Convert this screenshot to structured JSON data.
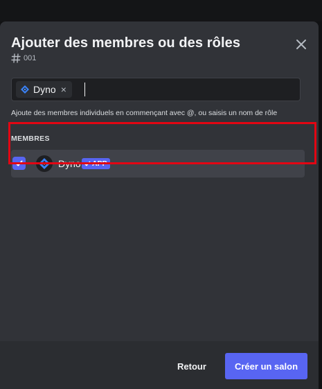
{
  "modal": {
    "title": "Ajouter des membres ou des rôles",
    "channel_name": "001"
  },
  "search": {
    "chip_label": "Dyno",
    "chip_remove": "×",
    "hint": "Ajoute des membres individuels en commençant avec @, ou saisis un nom de rôle"
  },
  "members": {
    "section_label": "MEMBRES",
    "items": [
      {
        "name": "Dyno",
        "badge": "APP",
        "checked": true
      }
    ]
  },
  "footer": {
    "back_label": "Retour",
    "create_label": "Créer un salon"
  },
  "colors": {
    "accent": "#5865f2",
    "modal_bg": "#313338",
    "footer_bg": "#2b2d31",
    "highlight": "#e30613"
  },
  "icons": [
    "close-icon",
    "hash-icon",
    "dyno-icon",
    "check-icon"
  ]
}
